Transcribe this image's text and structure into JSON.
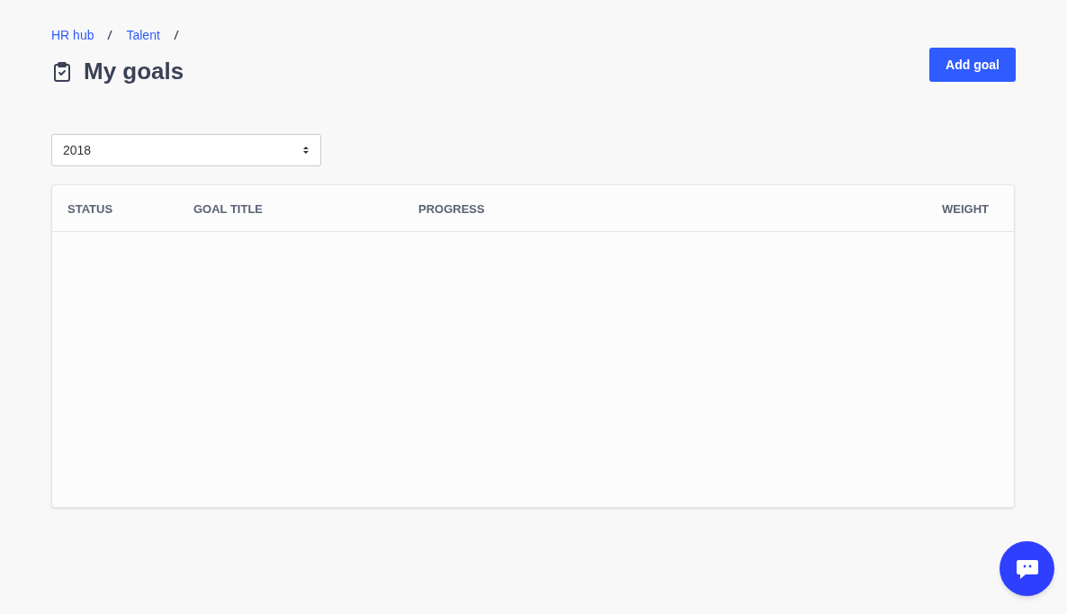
{
  "breadcrumb": [
    {
      "label": "HR hub",
      "link": true
    },
    {
      "label": "Talent",
      "link": true
    }
  ],
  "title": "My goals",
  "add_button": "Add goal",
  "year_select": {
    "value": "2018"
  },
  "table": {
    "columns": [
      "STATUS",
      "GOAL TITLE",
      "PROGRESS",
      "WEIGHT"
    ]
  }
}
